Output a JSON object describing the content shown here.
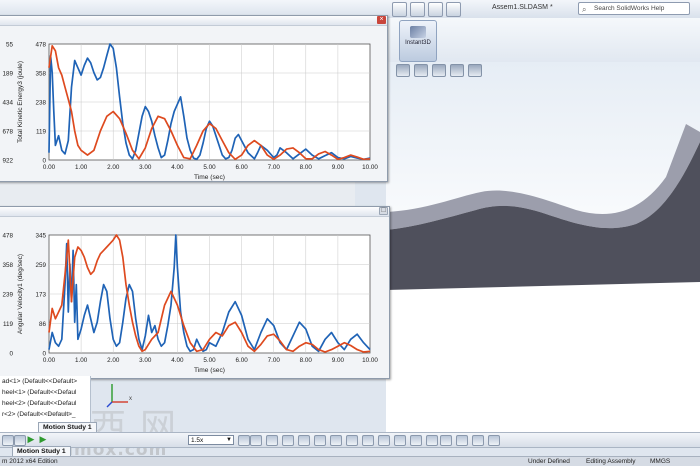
{
  "app": {
    "document_title": "Assem1.SLDASM *",
    "help_search_placeholder": "Search SolidWorks Help",
    "instant3d_label": "Instant3D",
    "icon_names": [
      "select-icon",
      "rebuild-icon",
      "options-icon",
      "view-orientation-icon",
      "display-style-icon",
      "hide-show-icon",
      "edit-appearance-icon",
      "scene-icon"
    ]
  },
  "tree": {
    "items": [
      "ad<1> (Default<<Default>",
      "heel<1> (Default<<Defaul",
      "heel<2> (Default<<Defaul",
      "r<2> (Default<<Default>_"
    ]
  },
  "motion": {
    "study_tab_1": "Motion Study 1",
    "study_tab_2": "Motion Study 1",
    "speed_value": "1.5x"
  },
  "status": {
    "left": "m 2012 x64 Edition",
    "under_defined": "Under Defined",
    "editing": "Editing Assembly",
    "units": "MMGS"
  },
  "watermark": {
    "chinese": "三西网",
    "url": "3dmox.com"
  },
  "colors": {
    "series_blue": "#1f63b6",
    "series_orange": "#de4a1f",
    "model_face": "#4f505c",
    "model_top": "#9c9eac"
  },
  "chart_data": [
    {
      "type": "line",
      "title": "",
      "xlabel": "Time (sec)",
      "ylabel": "Total Kinetic Energy3 (joule)",
      "xlim": [
        0,
        10
      ],
      "x_ticks": [
        "0.00",
        "1.00",
        "2.00",
        "3.00",
        "4.00",
        "5.00",
        "6.00",
        "7.00",
        "8.00",
        "9.00",
        "10.00"
      ],
      "y_ticks_right": [
        "478",
        "358",
        "238",
        "119",
        "0"
      ],
      "y_ticks_left": [
        "55",
        "189",
        "434",
        "678",
        "922"
      ],
      "ylim": [
        0,
        478
      ],
      "grid": true,
      "series": [
        {
          "color": "blue",
          "x": [
            0,
            0.05,
            0.1,
            0.15,
            0.2,
            0.3,
            0.4,
            0.5,
            0.6,
            0.7,
            0.8,
            0.9,
            1.0,
            1.1,
            1.2,
            1.3,
            1.4,
            1.5,
            1.6,
            1.7,
            1.8,
            1.9,
            2.0,
            2.1,
            2.2,
            2.3,
            2.4,
            2.5,
            2.6,
            2.7,
            2.8,
            2.9,
            3.0,
            3.1,
            3.2,
            3.3,
            3.4,
            3.5,
            3.6,
            3.7,
            3.8,
            3.9,
            4.0,
            4.1,
            4.2,
            4.3,
            4.4,
            4.5,
            4.6,
            4.7,
            4.8,
            4.9,
            5.0,
            5.1,
            5.2,
            5.3,
            5.4,
            5.5,
            5.6,
            5.7,
            5.8,
            5.9,
            6.0,
            6.2,
            6.4,
            6.5,
            6.6,
            6.8,
            7.0,
            7.1,
            7.2,
            7.4,
            7.6,
            7.8,
            8.0,
            8.2,
            8.4,
            8.6,
            8.8,
            9.0,
            9.2,
            9.4,
            9.6,
            9.8,
            10.0
          ],
          "values": [
            30,
            430,
            360,
            200,
            60,
            100,
            40,
            25,
            80,
            300,
            410,
            380,
            350,
            390,
            420,
            400,
            360,
            330,
            340,
            380,
            430,
            478,
            460,
            380,
            260,
            150,
            70,
            20,
            5,
            40,
            110,
            180,
            220,
            200,
            160,
            100,
            50,
            10,
            20,
            80,
            150,
            200,
            230,
            260,
            180,
            90,
            40,
            8,
            3,
            20,
            70,
            130,
            160,
            140,
            100,
            60,
            20,
            5,
            10,
            40,
            90,
            105,
            80,
            30,
            5,
            30,
            60,
            40,
            10,
            20,
            50,
            30,
            5,
            25,
            45,
            20,
            5,
            18,
            30,
            10,
            5,
            15,
            8,
            3,
            8
          ]
        },
        {
          "color": "orange",
          "x": [
            0,
            0.1,
            0.2,
            0.3,
            0.4,
            0.5,
            0.6,
            0.7,
            0.8,
            0.9,
            1.0,
            1.2,
            1.4,
            1.6,
            1.8,
            2.0,
            2.2,
            2.4,
            2.6,
            2.8,
            3.0,
            3.2,
            3.4,
            3.6,
            3.8,
            4.0,
            4.2,
            4.4,
            4.6,
            4.8,
            5.0,
            5.2,
            5.4,
            5.6,
            5.8,
            6.0,
            6.2,
            6.4,
            6.6,
            6.8,
            7.0,
            7.2,
            7.4,
            7.6,
            7.8,
            8.0,
            8.2,
            8.4,
            8.6,
            8.8,
            9.0,
            9.2,
            9.4,
            9.6,
            9.8,
            10.0
          ],
          "values": [
            380,
            470,
            450,
            380,
            350,
            300,
            250,
            200,
            120,
            60,
            40,
            20,
            40,
            120,
            180,
            200,
            170,
            110,
            40,
            5,
            50,
            130,
            180,
            170,
            120,
            60,
            10,
            5,
            60,
            120,
            150,
            130,
            80,
            30,
            3,
            20,
            60,
            80,
            60,
            20,
            3,
            20,
            45,
            50,
            30,
            5,
            5,
            25,
            35,
            20,
            3,
            10,
            20,
            12,
            3,
            5
          ]
        }
      ]
    },
    {
      "type": "line",
      "title": "",
      "xlabel": "Time (sec)",
      "ylabel": "Angular Velocity1 (deg/sec)",
      "xlim": [
        0,
        10
      ],
      "x_ticks": [
        "0.00",
        "1.00",
        "2.00",
        "3.00",
        "4.00",
        "5.00",
        "6.00",
        "7.00",
        "8.00",
        "9.00",
        "10.00"
      ],
      "y_ticks_right": [
        "345",
        "259",
        "173",
        "86",
        "0"
      ],
      "y_ticks_left": [
        "478",
        "358",
        "239",
        "119",
        "0"
      ],
      "ylim": [
        0,
        345
      ],
      "grid": true,
      "series": [
        {
          "color": "blue",
          "x": [
            0,
            0.1,
            0.2,
            0.3,
            0.4,
            0.5,
            0.55,
            0.6,
            0.65,
            0.7,
            0.75,
            0.8,
            0.85,
            0.9,
            1.0,
            1.1,
            1.2,
            1.3,
            1.4,
            1.5,
            1.6,
            1.7,
            1.8,
            1.9,
            2.0,
            2.1,
            2.2,
            2.3,
            2.4,
            2.5,
            2.6,
            2.7,
            2.8,
            2.9,
            3.0,
            3.1,
            3.2,
            3.3,
            3.4,
            3.5,
            3.6,
            3.7,
            3.8,
            3.9,
            3.95,
            4.0,
            4.1,
            4.2,
            4.3,
            4.4,
            4.5,
            4.6,
            4.7,
            4.8,
            4.9,
            5.0,
            5.2,
            5.4,
            5.6,
            5.8,
            6.0,
            6.2,
            6.4,
            6.6,
            6.8,
            7.0,
            7.2,
            7.4,
            7.6,
            7.8,
            8.0,
            8.2,
            8.4,
            8.6,
            8.8,
            9.0,
            9.2,
            9.4,
            9.6,
            9.8,
            10.0
          ],
          "values": [
            10,
            60,
            30,
            20,
            40,
            200,
            320,
            120,
            260,
            150,
            300,
            90,
            200,
            40,
            70,
            110,
            140,
            100,
            60,
            90,
            150,
            200,
            180,
            100,
            40,
            20,
            30,
            90,
            160,
            200,
            180,
            100,
            40,
            10,
            50,
            110,
            60,
            80,
            40,
            20,
            30,
            80,
            140,
            250,
            345,
            250,
            120,
            60,
            20,
            5,
            10,
            40,
            20,
            5,
            10,
            30,
            20,
            60,
            120,
            150,
            110,
            40,
            10,
            60,
            100,
            80,
            30,
            10,
            50,
            90,
            70,
            20,
            5,
            40,
            60,
            30,
            10,
            40,
            55,
            30,
            10
          ]
        },
        {
          "color": "orange",
          "x": [
            0,
            0.1,
            0.2,
            0.3,
            0.4,
            0.5,
            0.6,
            0.7,
            0.8,
            0.9,
            1.0,
            1.1,
            1.2,
            1.3,
            1.4,
            1.5,
            1.6,
            1.7,
            1.8,
            1.9,
            2.0,
            2.1,
            2.2,
            2.3,
            2.4,
            2.5,
            2.6,
            2.7,
            2.8,
            2.9,
            3.0,
            3.2,
            3.4,
            3.6,
            3.8,
            4.0,
            4.2,
            4.4,
            4.6,
            4.8,
            5.0,
            5.2,
            5.4,
            5.6,
            5.8,
            6.0,
            6.2,
            6.4,
            6.6,
            6.8,
            7.0,
            7.2,
            7.4,
            7.6,
            7.8,
            8.0,
            8.2,
            8.4,
            8.6,
            8.8,
            9.0,
            9.2,
            9.4,
            9.6,
            9.8,
            10.0
          ],
          "values": [
            60,
            130,
            100,
            120,
            140,
            230,
            330,
            150,
            280,
            310,
            300,
            280,
            250,
            230,
            240,
            270,
            290,
            300,
            310,
            320,
            330,
            345,
            330,
            280,
            200,
            140,
            90,
            50,
            20,
            5,
            10,
            40,
            60,
            140,
            180,
            140,
            80,
            30,
            5,
            10,
            40,
            60,
            50,
            80,
            90,
            60,
            20,
            5,
            25,
            50,
            55,
            35,
            10,
            5,
            20,
            30,
            25,
            10,
            3,
            10,
            20,
            30,
            22,
            10,
            3,
            5
          ]
        }
      ]
    }
  ]
}
